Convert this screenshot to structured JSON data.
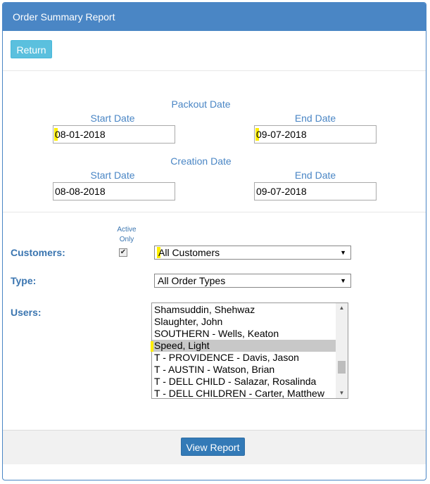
{
  "header": {
    "title": "Order Summary Report"
  },
  "toolbar": {
    "return_label": "Return"
  },
  "packout": {
    "heading": "Packout Date",
    "start_label": "Start Date",
    "end_label": "End Date",
    "start_value": "08-01-2018",
    "end_value": "09-07-2018"
  },
  "creation": {
    "heading": "Creation Date",
    "start_label": "Start Date",
    "end_label": "End Date",
    "start_value": "08-08-2018",
    "end_value": "09-07-2018"
  },
  "filters": {
    "customers_label": "Customers:",
    "active_only_line1": "Active",
    "active_only_line2": "Only",
    "active_only_checked": true,
    "customers_value": "All Customers",
    "type_label": "Type:",
    "type_value": "All Order Types",
    "users_label": "Users:",
    "users_items": [
      "Shamsuddin, Shehwaz",
      "Slaughter, John",
      "SOUTHERN - Wells, Keaton",
      "Speed, Light",
      "T - PROVIDENCE - Davis, Jason",
      "T - AUSTIN - Watson, Brian",
      "T - DELL CHILD - Salazar, Rosalinda",
      "T - DELL CHILDREN - Carter, Matthew"
    ],
    "users_selected": "Speed, Light"
  },
  "footer": {
    "view_report_label": "View Report"
  },
  "colors": {
    "primary": "#4a86c5",
    "info": "#5bc0de",
    "button": "#337ab7",
    "highlight": "#ffee00"
  }
}
